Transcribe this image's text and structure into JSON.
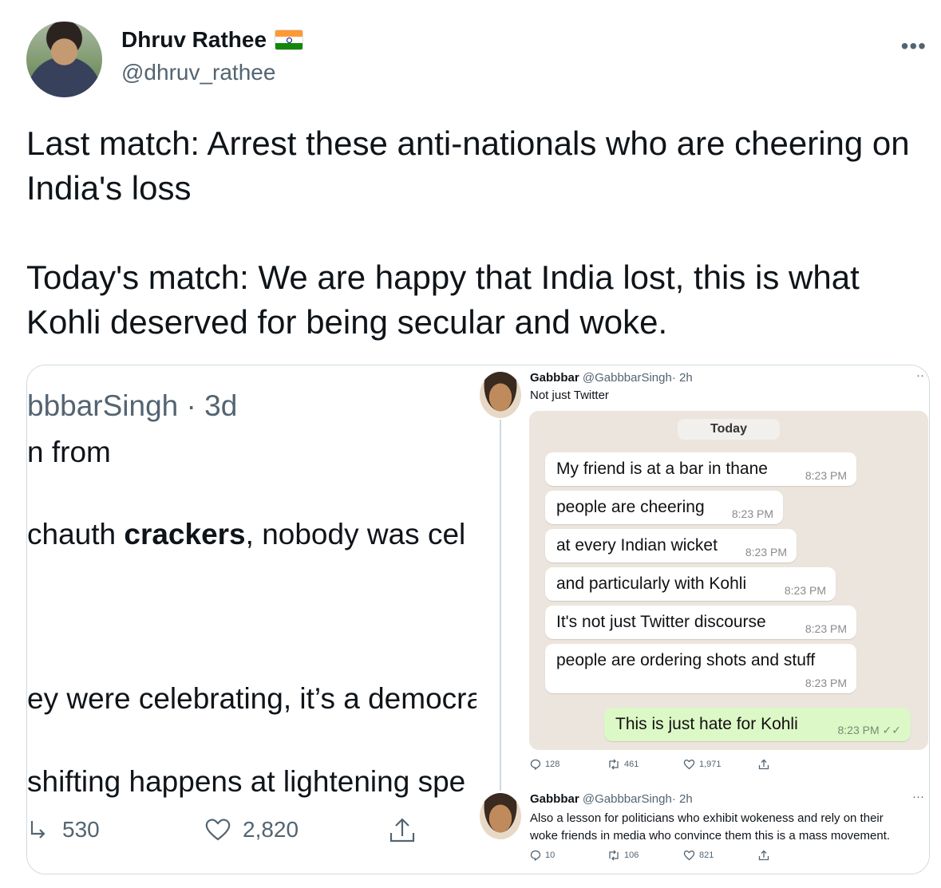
{
  "author": {
    "name": "Dhruv Rathee",
    "handle": "@dhruv_rathee",
    "flag_emoji": "india-flag",
    "more_label": "•••"
  },
  "tweet": {
    "para1": "Last match: Arrest these anti-nationals who are cheering on India's loss",
    "para2": "Today's match: We are happy that India lost, this is what Kohli deserved for being secular and woke."
  },
  "left_screenshot": {
    "handle_meta": "bbbarSingh · 3d",
    "line1": "n from",
    "line2_prefix": "chauth ",
    "line2_bold": "crackers",
    "line2_suffix": ", nobody was cel",
    "line3": "ey were celebrating, it’s a democra",
    "line4": "shifting happens at lightening spe",
    "retweets": "530",
    "likes": "2,820"
  },
  "right_screenshot": {
    "tweet1": {
      "name": "Gabbbar",
      "handle": "@GabbbarSingh",
      "time": "· 2h",
      "text": "Not just Twitter",
      "replies": "128",
      "retweets": "461",
      "likes": "1,971"
    },
    "chat": {
      "day": "Today",
      "messages": [
        {
          "text": "My friend is at a bar in thane",
          "time": "8:23 PM"
        },
        {
          "text": "people are cheering",
          "time": "8:23 PM"
        },
        {
          "text": "at every Indian wicket",
          "time": "8:23 PM"
        },
        {
          "text": "and particularly with Kohli",
          "time": "8:23 PM"
        },
        {
          "text": "It's not just Twitter discourse",
          "time": "8:23 PM"
        },
        {
          "text": "people are ordering shots and stuff",
          "time": "8:23 PM"
        }
      ],
      "outgoing": {
        "text": "This is just hate for Kohli",
        "time": "8:23 PM"
      }
    },
    "tweet2": {
      "name": "Gabbbar",
      "handle": "@GabbbarSingh",
      "time": "· 2h",
      "line1": "Also a lesson for politicians who exhibit wokeness and rely on their",
      "line2": "woke friends in media who convince them this is a mass movement.",
      "replies": "10",
      "retweets": "106",
      "likes": "821"
    }
  },
  "colors": {
    "text": "#0f1419",
    "secondary": "#536471",
    "border": "#cfd9de",
    "chat_bg": "#ece5dd",
    "outgoing_bubble": "#dcf8c6"
  }
}
